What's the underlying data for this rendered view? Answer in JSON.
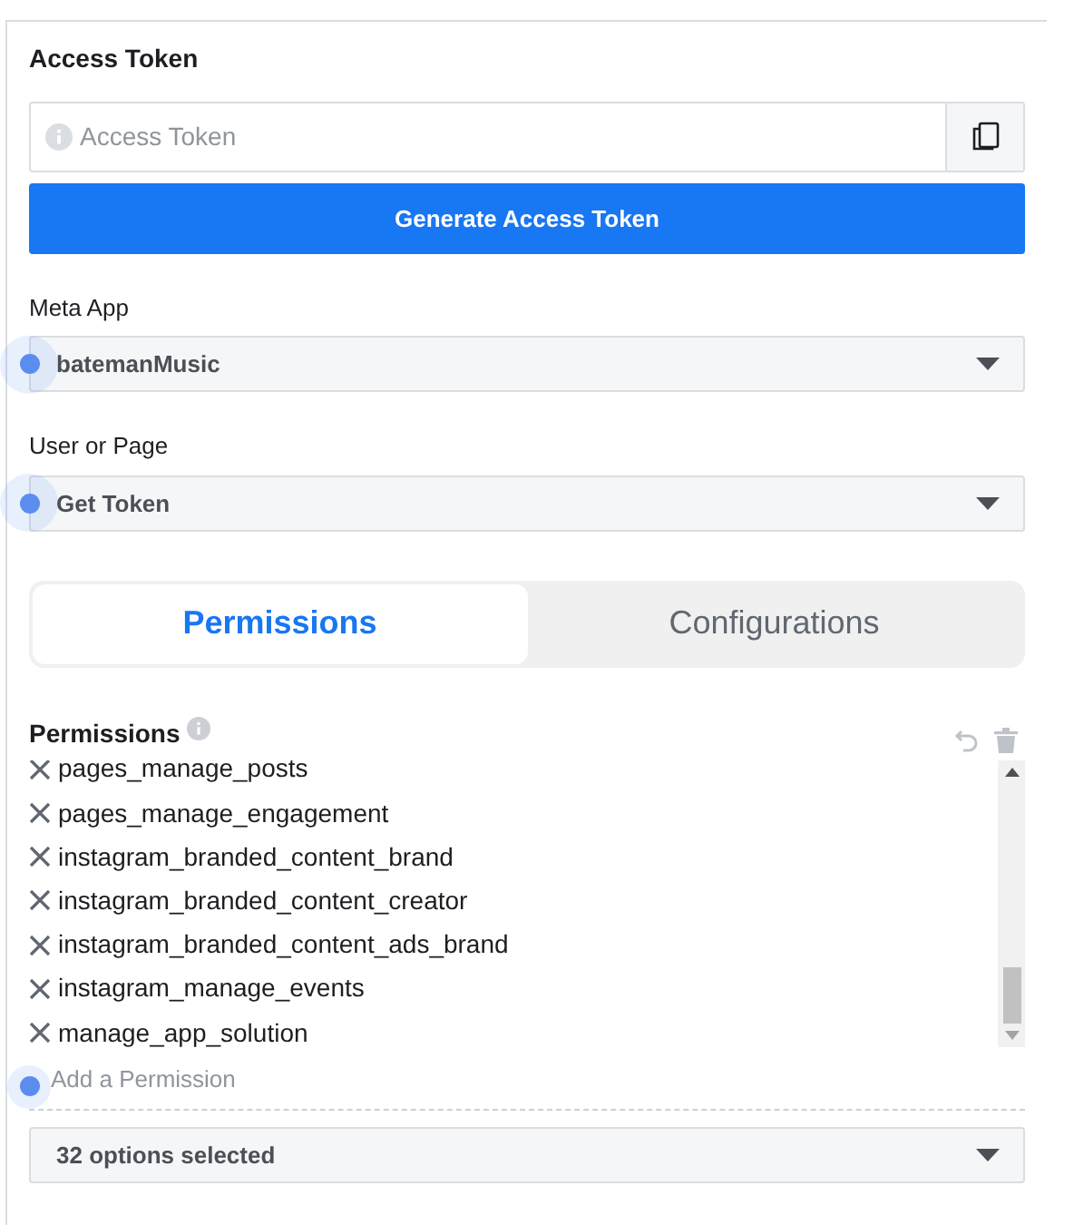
{
  "access_token": {
    "title": "Access Token",
    "placeholder": "Access Token",
    "button": "Generate Access Token"
  },
  "selects": [
    {
      "label": "Meta App",
      "value": "batemanMusic",
      "indicator": true
    },
    {
      "label": "User or Page",
      "value": "Get Token",
      "indicator": true
    }
  ],
  "tabs": [
    {
      "label": "Permissions",
      "selected": true
    },
    {
      "label": "Configurations",
      "selected": false
    }
  ],
  "permissions": {
    "title": "Permissions",
    "items": [
      "pages_manage_posts",
      "pages_manage_engagement",
      "instagram_branded_content_brand",
      "instagram_branded_content_creator",
      "instagram_branded_content_ads_brand",
      "instagram_manage_events",
      "manage_app_solution"
    ],
    "add_placeholder": "Add a Permission",
    "add_indicator": true,
    "summary": "32 options selected"
  }
}
